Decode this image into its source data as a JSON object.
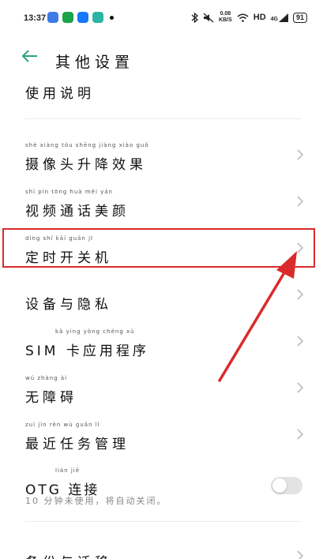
{
  "status_bar": {
    "time": "13:37",
    "net_speed_value": "0.08",
    "net_speed_unit": "KB/S",
    "hd_label": "HD",
    "signal_label": "4G",
    "battery": "91",
    "icons": [
      "app-icon-blue",
      "shield-icon",
      "alipay-icon",
      "app-icon-teal",
      "bluetooth-icon",
      "mute-icon",
      "wifi-icon",
      "signal-icon"
    ],
    "colors": {
      "alipay": "#1677ff",
      "shield": "#1aa34a",
      "teal": "#2bb5a5",
      "blue_app": "#3d7be6"
    }
  },
  "header": {
    "title": "其他设置",
    "back_icon": "back-arrow-icon",
    "accent_color": "#2aa876"
  },
  "settings": {
    "partial_top_label": "使用说明",
    "items": [
      {
        "label": "摄像头升降效果",
        "pinyin": "shè xiàng tóu shēng jiàng xiào guǒ"
      },
      {
        "label": "视频通话美颜",
        "pinyin": "shì pín tōng huà měi yán"
      },
      {
        "label": "定时开关机",
        "pinyin": "dìng shí kāi guān jī"
      },
      {
        "label": "设备与隐私",
        "pinyin": ""
      },
      {
        "label": "SIM 卡应用程序",
        "pinyin": "kǎ yìng yòng chéng xù"
      },
      {
        "label": "无障碍",
        "pinyin": "wú zhàng ài"
      },
      {
        "label": "最近任务管理",
        "pinyin": "zuì jìn rèn wù guǎn lǐ"
      },
      {
        "label": "OTG 连接",
        "pinyin": "lián jiē",
        "subtitle": "10 分钟未使用，将自动关闭。",
        "toggle_on": false
      }
    ],
    "partial_bottom_label": "备份与迁移"
  },
  "annotation": {
    "highlight_color": "#d92b2b",
    "highlighted_item": "定时开关机"
  }
}
